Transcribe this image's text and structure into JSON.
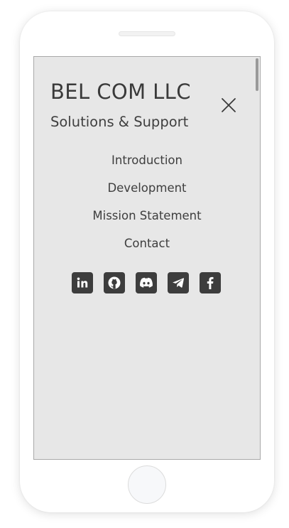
{
  "brand": {
    "title": "BEL COM LLC",
    "subtitle": "Solutions & Support"
  },
  "menu": {
    "items": [
      {
        "label": "Introduction"
      },
      {
        "label": "Development"
      },
      {
        "label": "Mission Statement"
      },
      {
        "label": "Contact"
      }
    ]
  },
  "social": [
    {
      "icon": "linkedin-icon"
    },
    {
      "icon": "github-icon"
    },
    {
      "icon": "discord-icon"
    },
    {
      "icon": "telegram-icon"
    },
    {
      "icon": "facebook-icon"
    }
  ],
  "colors": {
    "menu_background": "#e7e7e7",
    "text": "#3a3a3a",
    "icon_tile": "#3d3d3d"
  }
}
